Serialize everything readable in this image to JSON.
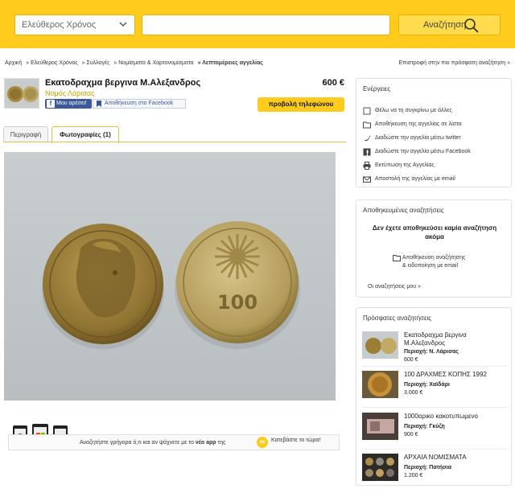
{
  "search": {
    "category": "Ελεύθερος Χρόνος",
    "query": "",
    "button_label": "Αναζήτηση"
  },
  "breadcrumb": [
    "Αρχική",
    "» Ελεύθερος Χρόνος",
    "» Συλλογές",
    "» Νομίσματα & Χαρτονομίσματα",
    "» Λεπτομέρειες αγγελίας"
  ],
  "return_link": "Επιστροφή στην πιο πρόσφατη αναζήτηση »",
  "listing": {
    "title": "Εκατοδραχμα βεργινα Μ.Αλεξανδρος",
    "region": "Νομός Λάρισας",
    "price": "600 €",
    "fb_like": "Μου αρέσει!",
    "fb_save": "Αποθήκευση στο Facebook",
    "phone_button": "προβολή τηλεφώνου"
  },
  "tabs": [
    "Περιγραφή",
    "Φωτογραφίες (1)"
  ],
  "app_bar": {
    "text_before": "Αναζητήστε γρήγορα ό,τι και αν ψάχνετε με το ",
    "text_bold": "νέο app",
    "text_after": " της",
    "badge": "xe",
    "cta": "Κατεβάστε το τώρα!"
  },
  "actions": {
    "title": "Ενέργειες",
    "items": [
      {
        "label": "Θέλω να τη συγκρίνω με άλλες",
        "icon": "checkbox-icon"
      },
      {
        "label": "Αποθήκευση της αγγελίας σε λίστα",
        "icon": "folder-icon"
      },
      {
        "label": "Διαδώστε την αγγελία μέσω twitter",
        "icon": "twitter-icon"
      },
      {
        "label": "Διαδώστε την αγγελία μέσω Facebook",
        "icon": "facebook-icon"
      },
      {
        "label": "Εκτύπωση της Αγγελίας",
        "icon": "print-icon"
      },
      {
        "label": "Αποστολή της αγγελίας με email",
        "icon": "email-icon"
      }
    ]
  },
  "saved_searches": {
    "title": "Αποθηκευμένες αναζητήσεις",
    "empty_message": "Δεν έχετε αποθηκεύσει καμία αναζήτηση ακόμα",
    "info_line1": "Αποθήκευση αναζήτησης",
    "info_line2": "& ειδοποίηση με email",
    "my_searches": "Οι αναζητήσεις μου »"
  },
  "recent_searches": {
    "title": "Πρόσφατες αναζητήσεις",
    "region_prefix": "Περιοχή:",
    "items": [
      {
        "title": "Εκατοδραχμα βεργινα Μ.Αλεξανδρος",
        "region": "Περιοχή: Ν. Λάρισας",
        "price": "600 €"
      },
      {
        "title": "100 ΔΡΑΧΜΕΣ ΚΟΠΗΣ 1992",
        "region": "Περιοχή: Χαϊδάρι",
        "price": "3.000 €"
      },
      {
        "title": "1000αρικο κακοτυπωμενο",
        "region": "Περιοχή: Γκύζη",
        "price": "900 €"
      },
      {
        "title": "ΑΡΧΑΙΑ ΝΟΜΙΣΜΑΤΑ",
        "region": "Περιοχή: Πατήσια",
        "price": "1.200 €"
      }
    ]
  },
  "colors": {
    "brand_yellow": "#ffcc1d",
    "link_gold": "#c8a400",
    "facebook_blue": "#3b5998"
  }
}
